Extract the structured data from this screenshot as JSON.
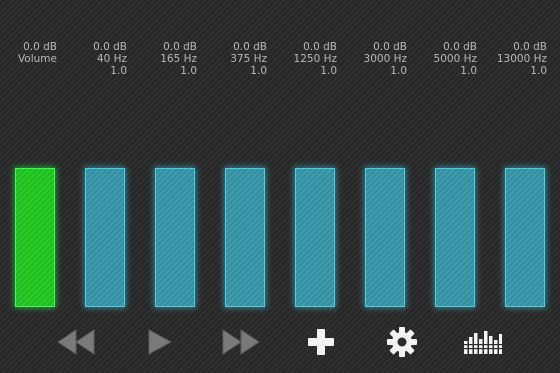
{
  "colors": {
    "volume_bar": "#1ec81e",
    "volume_glow": "#33ff55",
    "band_bar": "#3596a8",
    "band_glow": "#44d0e6",
    "label_text": "#b8b8b8",
    "dim_icon": "#7a7a7a",
    "bright_icon": "#f2f2f2"
  },
  "channels": [
    {
      "gain": "0.0 dB",
      "name": "Volume",
      "q": "",
      "level": 1.0
    },
    {
      "gain": "0.0 dB",
      "name": "40 Hz",
      "q": "1.0",
      "level": 1.0
    },
    {
      "gain": "0.0 dB",
      "name": "165 Hz",
      "q": "1.0",
      "level": 1.0
    },
    {
      "gain": "0.0 dB",
      "name": "375 Hz",
      "q": "1.0",
      "level": 1.0
    },
    {
      "gain": "0.0 dB",
      "name": "1250 Hz",
      "q": "1.0",
      "level": 1.0
    },
    {
      "gain": "0.0 dB",
      "name": "3000 Hz",
      "q": "1.0",
      "level": 1.0
    },
    {
      "gain": "0.0 dB",
      "name": "5000 Hz",
      "q": "1.0",
      "level": 1.0
    },
    {
      "gain": "0.0 dB",
      "name": "13000 Hz",
      "q": "1.0",
      "level": 1.0
    }
  ],
  "controls": [
    {
      "icon": "rewind-icon",
      "enabled": false
    },
    {
      "icon": "play-icon",
      "enabled": false
    },
    {
      "icon": "fast-forward-icon",
      "enabled": false
    },
    {
      "icon": "plus-icon",
      "enabled": true
    },
    {
      "icon": "gear-icon",
      "enabled": true
    },
    {
      "icon": "equalizer-icon",
      "enabled": true
    }
  ]
}
